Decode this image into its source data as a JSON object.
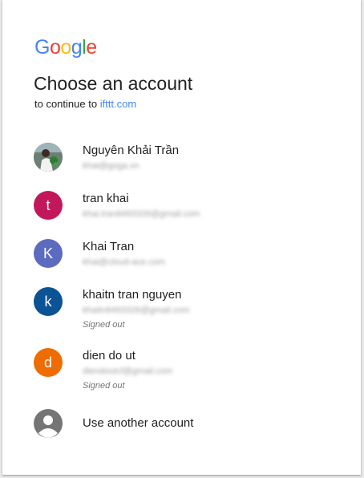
{
  "logo": {
    "letters": [
      "G",
      "o",
      "o",
      "g",
      "l",
      "e"
    ],
    "colors": [
      "#4285f4",
      "#ea4335",
      "#fbbc05",
      "#4285f4",
      "#34a853",
      "#ea4335"
    ]
  },
  "header": {
    "title": "Choose an account",
    "subtitle_prefix": "to continue to",
    "subtitle_link": "ifttt.com"
  },
  "accounts": [
    {
      "name": "Nguyên Khải Trần",
      "email": "khai@goga.vn",
      "avatar": "photo",
      "signed_out": ""
    },
    {
      "name": "tran khai",
      "email": "khai.tran8493326@gmail.com",
      "avatar_letter": "t",
      "avatar_color": "#c2185b",
      "signed_out": ""
    },
    {
      "name": "Khai Tran",
      "email": "khai@cloud-ace.com",
      "avatar_letter": "K",
      "avatar_color": "#5c6bc0",
      "signed_out": ""
    },
    {
      "name": "khaitn tran nguyen",
      "email": "khaitn8493326@gmail.com",
      "avatar_letter": "k",
      "avatar_color": "#0b5394",
      "signed_out": "Signed out"
    },
    {
      "name": "dien do ut",
      "email": "diendoutcf@gmail.com",
      "avatar_letter": "d",
      "avatar_color": "#ef6c00",
      "signed_out": "Signed out"
    }
  ],
  "use_another": {
    "label": "Use another account",
    "icon": "account-circle-icon"
  }
}
